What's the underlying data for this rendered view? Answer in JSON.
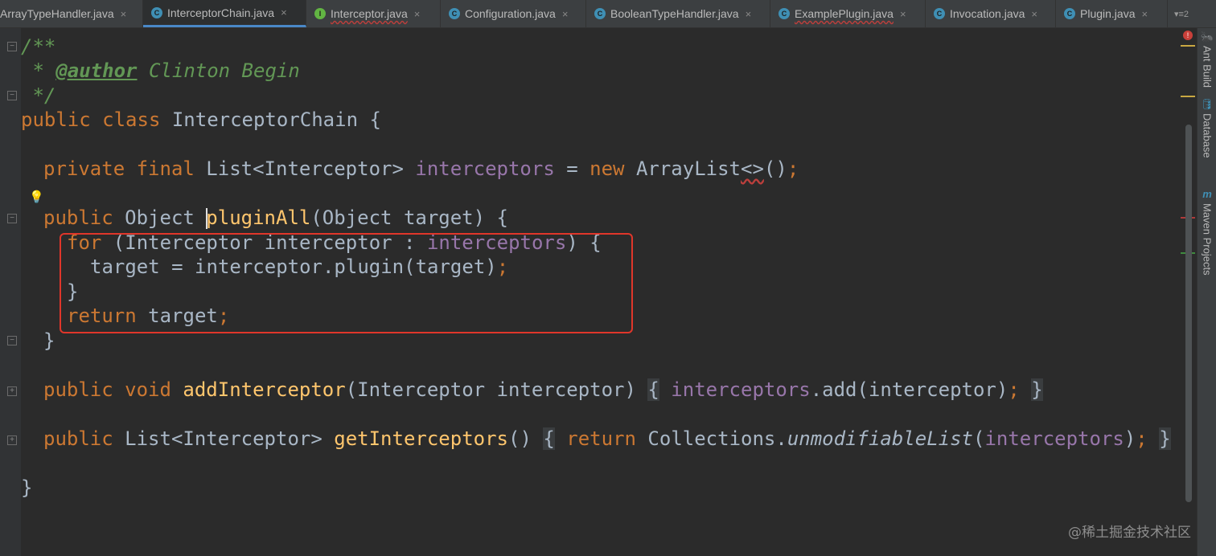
{
  "tabs": [
    {
      "label": "ArrayTypeHandler.java",
      "icon": "none",
      "active": false,
      "error": false
    },
    {
      "label": "InterceptorChain.java",
      "icon": "class",
      "active": true,
      "error": false
    },
    {
      "label": "Interceptor.java",
      "icon": "interface",
      "active": false,
      "error": true
    },
    {
      "label": "Configuration.java",
      "icon": "class",
      "active": false,
      "error": false
    },
    {
      "label": "BooleanTypeHandler.java",
      "icon": "class",
      "active": false,
      "error": false
    },
    {
      "label": "ExamplePlugin.java",
      "icon": "class",
      "active": false,
      "error": true
    },
    {
      "label": "Invocation.java",
      "icon": "class",
      "active": false,
      "error": false
    },
    {
      "label": "Plugin.java",
      "icon": "class",
      "active": false,
      "error": false
    }
  ],
  "tab_close": "×",
  "tab_icon_letters": {
    "class": "C",
    "interface": "I"
  },
  "tabs_overflow": {
    "label": "▾≡2"
  },
  "code": {
    "l1": "/**",
    "l2_a": " * ",
    "l2_tag": "@author",
    "l2_b": " Clinton Begin",
    "l3": " */",
    "l4_kw": "public class",
    "l4_rest": " InterceptorChain {",
    "l6_kw1": "private final",
    "l6_type": " List<Interceptor> ",
    "l6_field": "interceptors",
    "l6_eq": " = ",
    "l6_kw2": "new",
    "l6_ctor": " ArrayList",
    "l6_diamond": "<>",
    "l6_paren": "()",
    "l6_semi": ";",
    "l8_kw": "public",
    "l8_type": " Object ",
    "l8_fn": "pluginAll",
    "l8_rest": "(Object target) {",
    "l9_kw": "for",
    "l9_a": " (Interceptor interceptor : ",
    "l9_field": "interceptors",
    "l9_b": ") {",
    "l10_a": "target = interceptor.plugin(target)",
    "l10_semi": ";",
    "l11": "}",
    "l12_kw": "return",
    "l12_a": " target",
    "l12_semi": ";",
    "l13": "}",
    "l15_kw": "public void",
    "l15_sp": " ",
    "l15_fn": "addInterceptor",
    "l15_a": "(Interceptor interceptor)",
    "l15_ob": "{",
    "l15_field": "interceptors",
    "l15_b": ".add(interceptor)",
    "l15_semi": ";",
    "l15_cb": "}",
    "l17_kw": "public",
    "l17_type": " List<Interceptor> ",
    "l17_fn": "getInterceptors",
    "l17_a": "()",
    "l17_ob": "{",
    "l17_kw2": "return",
    "l17_b": " Collections.",
    "l17_it": "unmodifiableList",
    "l17_c": "(",
    "l17_field": "interceptors",
    "l17_d": ")",
    "l17_semi": ";",
    "l17_cb": "}",
    "l19": "}"
  },
  "right_tools": [
    {
      "label": "Ant Build",
      "icon": "ant-icon"
    },
    {
      "label": "Database",
      "icon": "database-icon"
    },
    {
      "label": "Maven Projects",
      "icon": "maven-icon"
    }
  ],
  "right_tool_glyphs": {
    "ant": "🐜",
    "database": "🛢",
    "maven": "m"
  },
  "watermark": "@稀土掘金技术社区",
  "error_badge": "!",
  "fold_glyphs": {
    "minus": "−",
    "plus": "+"
  },
  "bulb_glyph": "💡",
  "colors": {
    "highlight_box": "#e0362a",
    "keyword": "#cc7832",
    "field": "#9876aa",
    "method": "#ffc66d",
    "comment": "#629755"
  }
}
